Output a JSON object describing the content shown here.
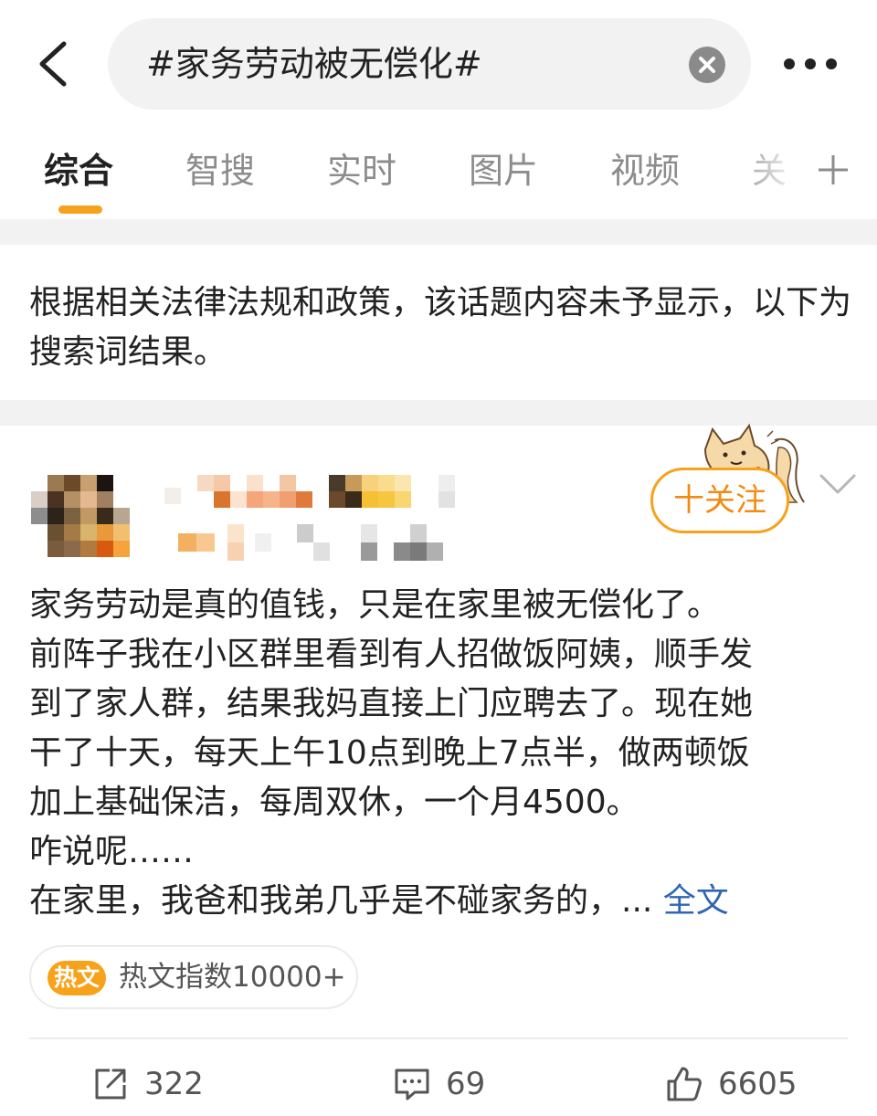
{
  "search": {
    "query": "#家务劳动被无偿化#"
  },
  "tabs": [
    {
      "label": "综合",
      "active": true
    },
    {
      "label": "智搜",
      "active": false
    },
    {
      "label": "实时",
      "active": false
    },
    {
      "label": "图片",
      "active": false
    },
    {
      "label": "视频",
      "active": false
    },
    {
      "label": "关",
      "active": false
    }
  ],
  "notice": "根据相关法律法规和政策，该话题内容未予显示，以下为搜索词结果。",
  "post": {
    "follow_label": "十关注",
    "lines": [
      "家务劳动是真的值钱，只是在家里被无偿化了。",
      "前阵子我在小区群里看到有人招做饭阿姨，顺手发",
      "到了家人群，结果我妈直接上门应聘去了。现在她",
      "干了十天，每天上午10点到晚上7点半，做两顿饭",
      "加上基础保洁，每周双休，一个月4500。",
      "咋说呢……",
      "在家里，我爸和我弟几乎是不碰家务的，... "
    ],
    "more_label": "全文",
    "hot_badge": "热文",
    "hot_text": "热文指数10000+"
  },
  "actions": {
    "repost": "322",
    "comment": "69",
    "like": "6605"
  },
  "colors": {
    "accent": "#f7a21b",
    "link": "#2f66b4",
    "divider": "#f2f2f2"
  }
}
